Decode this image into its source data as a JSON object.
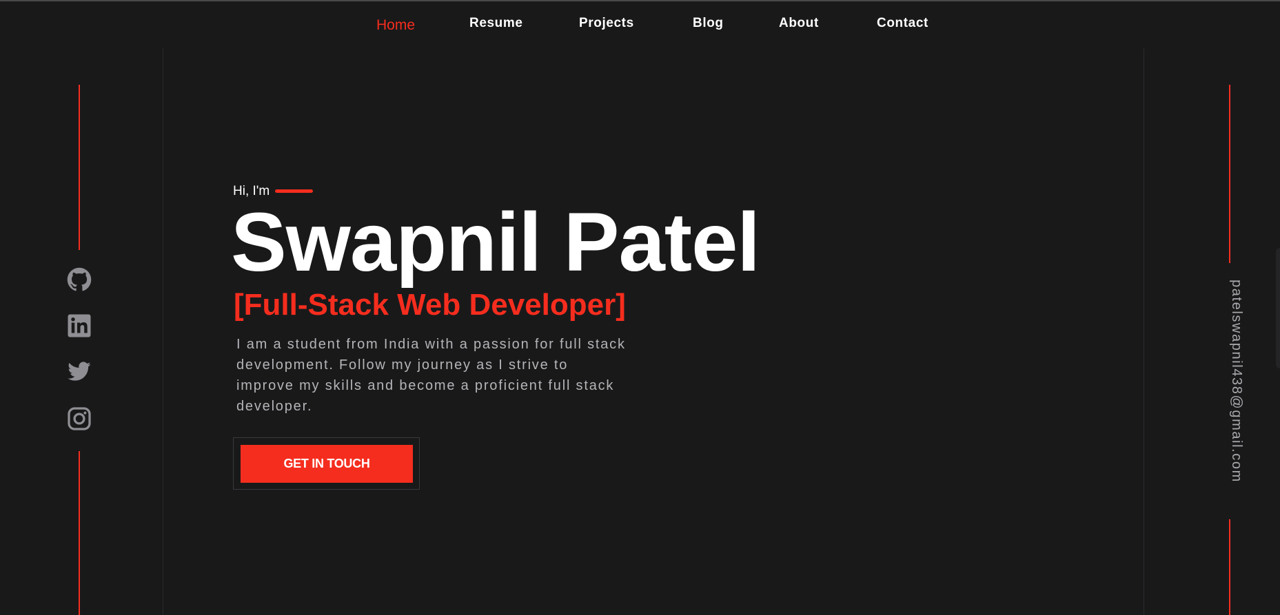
{
  "nav": {
    "items": [
      {
        "label": "Home",
        "active": true
      },
      {
        "label": "Resume",
        "active": false
      },
      {
        "label": "Projects",
        "active": false
      },
      {
        "label": "Blog",
        "active": false
      },
      {
        "label": "About",
        "active": false
      },
      {
        "label": "Contact",
        "active": false
      }
    ]
  },
  "social": {
    "icons": [
      "github-icon",
      "linkedin-icon",
      "twitter-icon",
      "instagram-icon"
    ]
  },
  "email": "patelswapnil438@gmail.com",
  "hero": {
    "greeting": "Hi, I'm",
    "name": "Swapnil Patel",
    "role": "[Full-Stack Web Developer]",
    "description": "I am a student from India with a passion for full stack development. Follow my journey as I strive to improve my skills and become a proficient full stack developer.",
    "cta": "GET IN TOUCH"
  },
  "colors": {
    "background": "#19191a",
    "accent": "#f52d1e",
    "text": "#ffffff",
    "muted": "#b5b5b9",
    "icon": "#8e8e93"
  }
}
